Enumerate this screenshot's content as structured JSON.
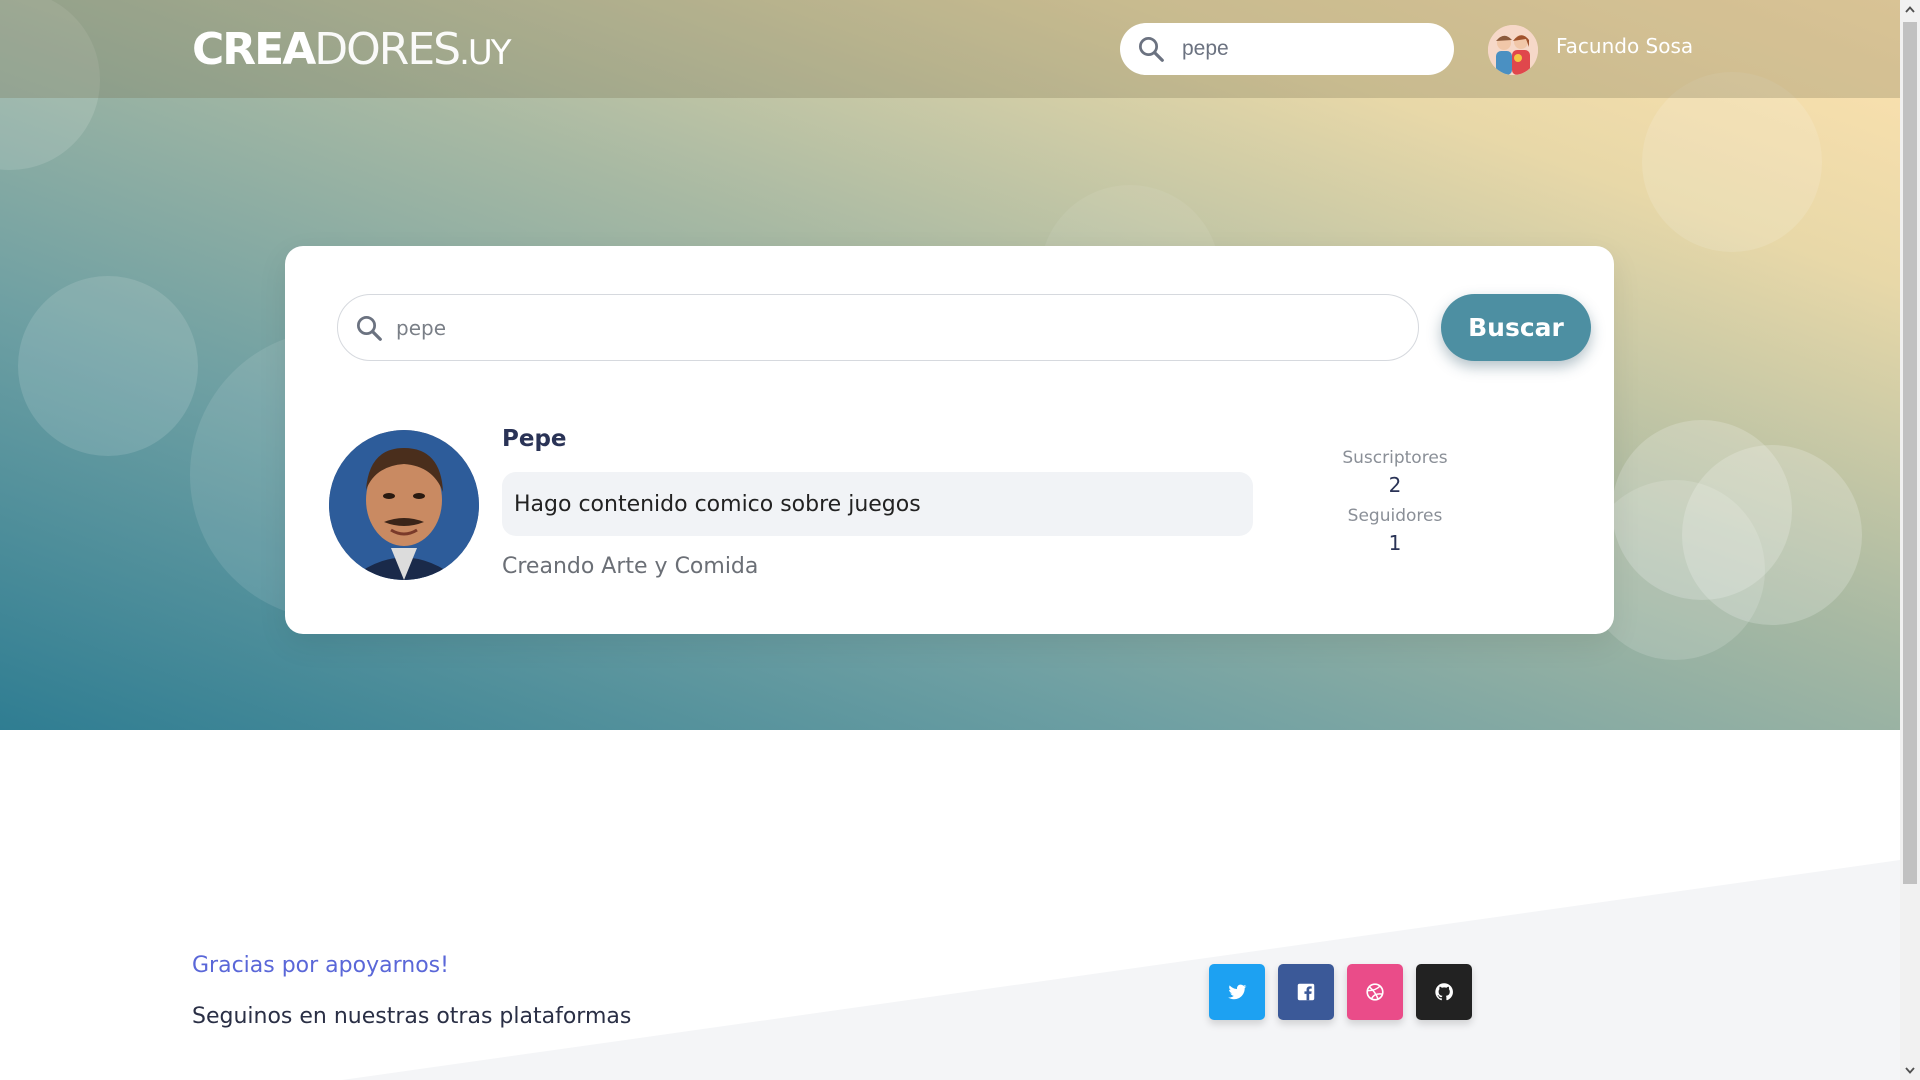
{
  "brand": {
    "logo_part1": "CREA",
    "logo_part2": "DORES",
    "logo_part3": ".UY"
  },
  "navbar": {
    "search": {
      "value": "pepe",
      "icon": "search-icon"
    },
    "user": {
      "name": "Facundo Sosa",
      "avatar": "user-avatar"
    }
  },
  "search": {
    "value": "pepe",
    "button_label": "Buscar"
  },
  "result": {
    "name": "Pepe",
    "description": "Hago contenido comico sobre juegos",
    "subtitle": "Creando Arte y Comida",
    "stats": [
      {
        "label": "Suscriptores",
        "value": "2"
      },
      {
        "label": "Seguidores",
        "value": "1"
      }
    ]
  },
  "footer": {
    "thanks": "Gracias por apoyarnos!",
    "follow": "Seguinos en nuestras otras plataformas",
    "social": [
      {
        "name": "twitter-icon",
        "color": "#1da1f2"
      },
      {
        "name": "facebook-icon",
        "color": "#3b5998"
      },
      {
        "name": "dribbble-icon",
        "color": "#ea4c89"
      },
      {
        "name": "github-icon",
        "color": "#222222"
      }
    ]
  },
  "colors": {
    "accent": "#4d8fa2",
    "heading": "#2a3356",
    "link": "#5a67d8"
  }
}
